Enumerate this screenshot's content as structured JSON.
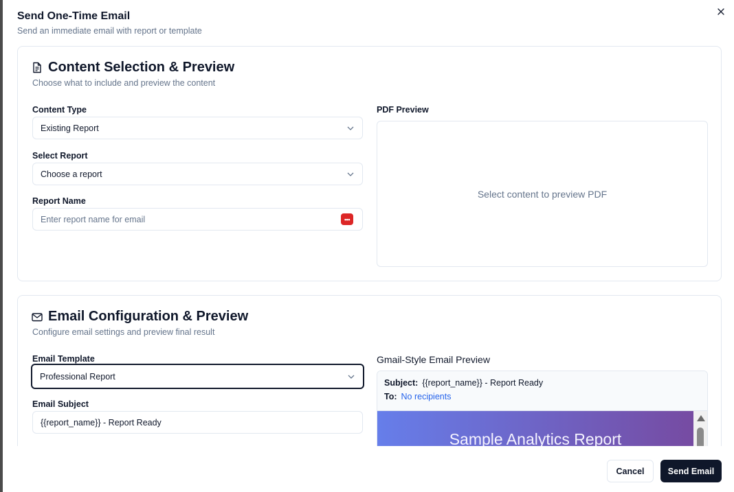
{
  "dialog": {
    "title": "Send One-Time Email",
    "subtitle": "Send an immediate email with report or template",
    "close_icon": "close-icon"
  },
  "content_section": {
    "icon": "document-icon",
    "title": "Content Selection & Preview",
    "description": "Choose what to include and preview the content",
    "content_type": {
      "label": "Content Type",
      "value": "Existing Report"
    },
    "select_report": {
      "label": "Select Report",
      "value": "Choose a report"
    },
    "report_name": {
      "label": "Report Name",
      "placeholder": "Enter report name for email",
      "value": "",
      "extension_icon": "password-manager-icon",
      "extension_glyph": "•••"
    },
    "pdf_preview": {
      "label": "PDF Preview",
      "empty_text": "Select content to preview PDF"
    }
  },
  "email_section": {
    "icon": "mail-icon",
    "title": "Email Configuration & Preview",
    "description": "Configure email settings and preview final result",
    "email_template": {
      "label": "Email Template",
      "value": "Professional Report"
    },
    "email_subject": {
      "label": "Email Subject",
      "value": "{{report_name}} - Report Ready"
    },
    "preview": {
      "label": "Gmail-Style Email Preview",
      "subject_label": "Subject:",
      "subject_value": "{{report_name}} - Report Ready",
      "to_label": "To:",
      "to_value": "No recipients",
      "hero_text": "Sample Analytics Report",
      "gradient_start": "#667eea",
      "gradient_end": "#764ba2"
    }
  },
  "footer": {
    "cancel_label": "Cancel",
    "send_label": "Send Email"
  },
  "colors": {
    "primary": "#0f172a",
    "muted": "#64748b",
    "border": "#e2e8f0",
    "link": "#2563eb",
    "password_manager": "#dc2626"
  }
}
